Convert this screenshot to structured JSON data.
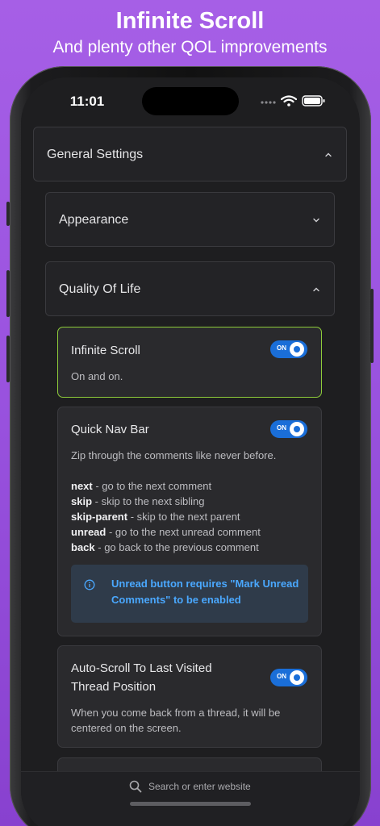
{
  "promo": {
    "title": "Infinite Scroll",
    "subtitle": "And plenty other QOL improvements"
  },
  "status_bar": {
    "time": "11:01",
    "icons": [
      "signal-dots-icon",
      "wifi-icon",
      "battery-icon"
    ]
  },
  "settings": {
    "general": {
      "label": "General Settings",
      "state": "expanded"
    },
    "appearance": {
      "label": "Appearance",
      "state": "collapsed"
    },
    "quality_of_life": {
      "label": "Quality Of Life",
      "state": "expanded"
    },
    "options": [
      {
        "title": "Infinite Scroll",
        "toggle": "ON",
        "description": "On and on."
      },
      {
        "title": "Quick Nav Bar",
        "toggle": "ON",
        "description": "Zip through the comments like never before.",
        "commands": [
          {
            "name": "next",
            "text": " - go to the next comment"
          },
          {
            "name": "skip",
            "text": " - skip to the next sibling"
          },
          {
            "name": "skip-parent",
            "text": " - skip to the next parent"
          },
          {
            "name": "unread",
            "text": " - go to the next unread comment"
          },
          {
            "name": "back",
            "text": " - go back to the previous comment"
          }
        ],
        "info": "Unread button requires \"Mark Unread Comments\" to be enabled"
      },
      {
        "title": "Auto-Scroll To Last Visited Thread Position",
        "toggle": "ON",
        "description": "When you come back from a thread, it will be centered on the screen."
      }
    ]
  },
  "browser": {
    "search_placeholder": "Search or enter website"
  },
  "colors": {
    "background_top": "#a65fe6",
    "accent_toggle": "#1a6ed8",
    "active_border": "#8ecc3a",
    "info_text": "#4aa8ff"
  }
}
